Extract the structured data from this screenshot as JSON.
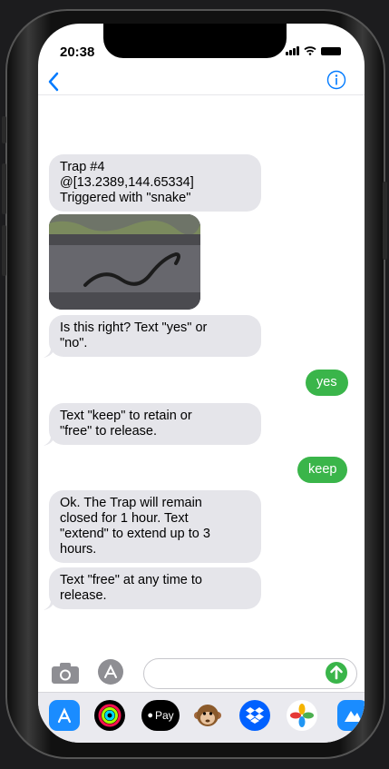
{
  "status_bar": {
    "time": "20:38"
  },
  "messages": {
    "m1": "Trap #4\n@[13.2389,144.65334]\nTriggered with \"snake\"",
    "m2": "Is this right? Text \"yes\" or\n\"no\".",
    "m3": "yes",
    "m4": "Text \"keep\" to retain or\n\"free\" to release.",
    "m5": "keep",
    "m6": "Ok. The Trap will remain\nclosed for 1 hour. Text\n\"extend\" to extend up to 3\nhours.",
    "m7": "Text \"free\" at any time to\nrelease."
  },
  "dock": {
    "applepay_label": "Pay"
  },
  "colors": {
    "accent": "#007aff",
    "outgoing": "#3ab54a",
    "incoming": "#e5e5ea"
  },
  "icons": [
    "chevron-left-icon",
    "info-icon",
    "camera-icon",
    "app-store-icon",
    "send-arrow-icon",
    "activity-rings-icon",
    "monkey-emoji-icon",
    "dropbox-icon",
    "photos-pinwheel-icon"
  ]
}
